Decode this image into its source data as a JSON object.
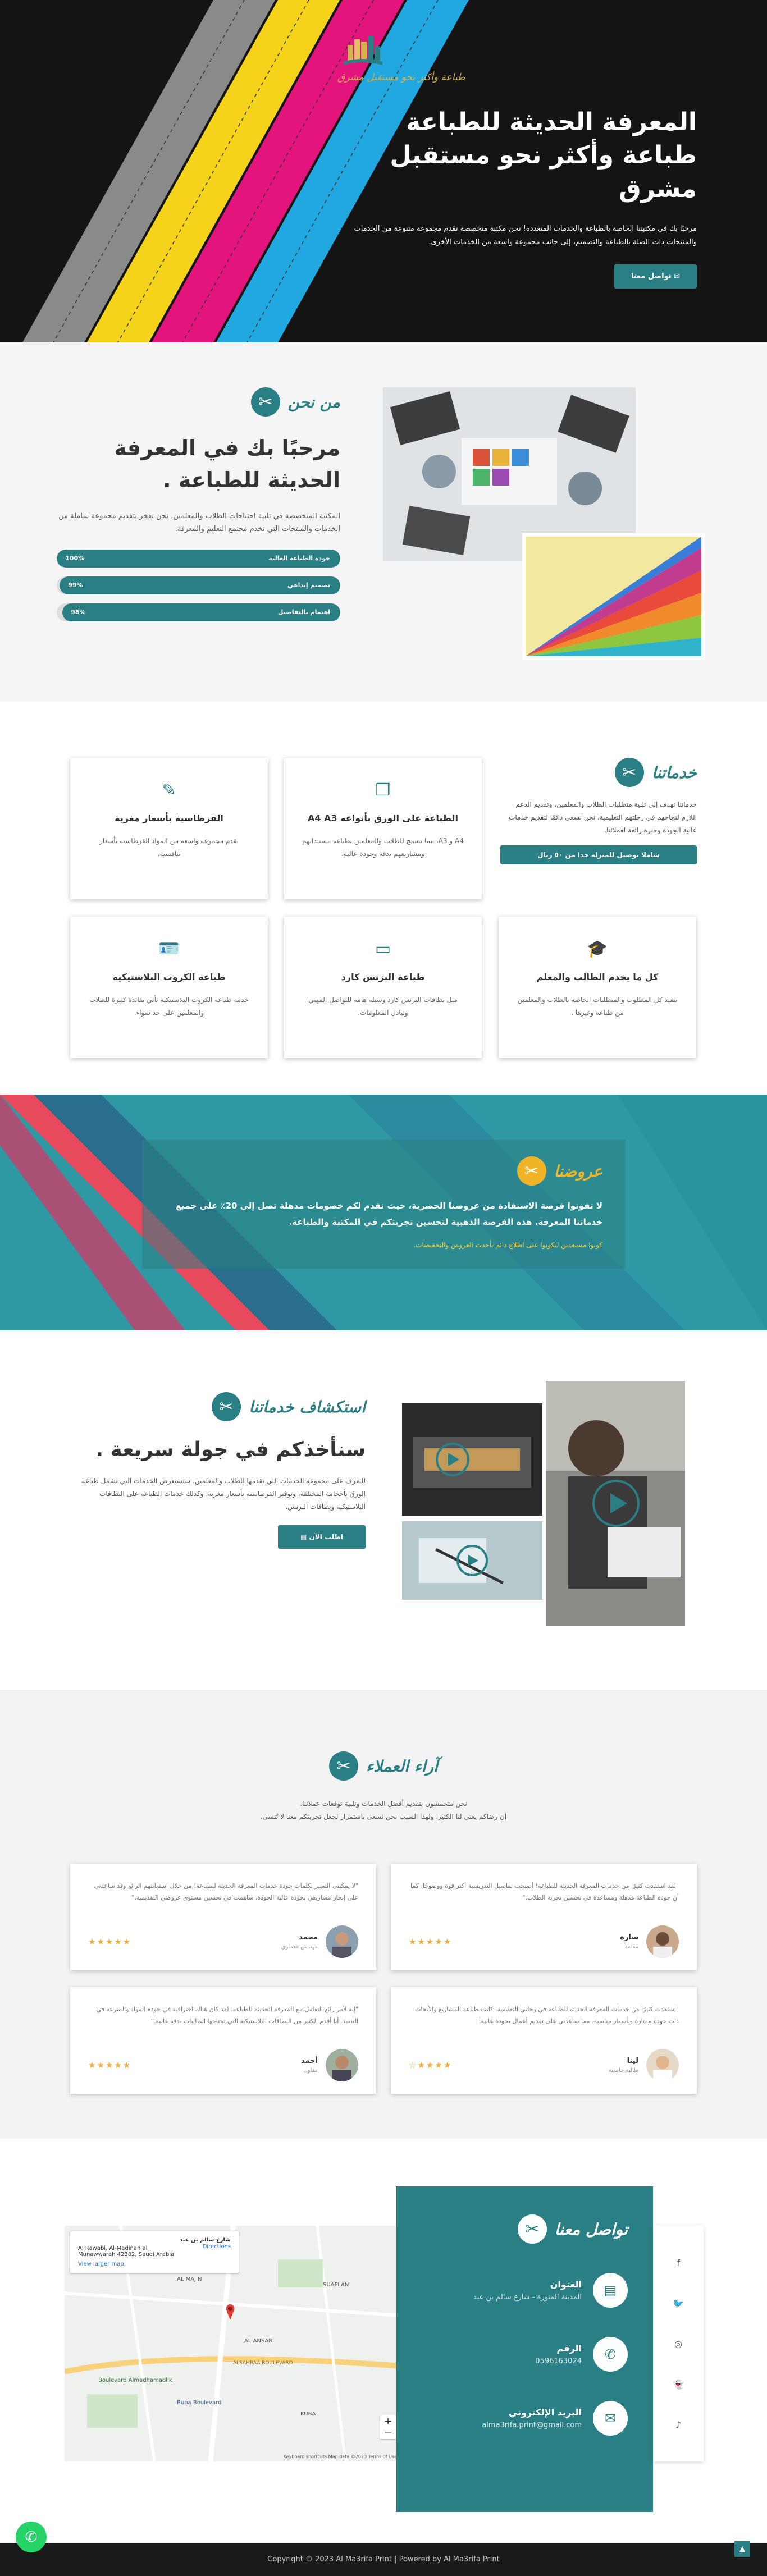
{
  "hero": {
    "tagline": "طباعة وأكثر نحو مستقبل مشرق",
    "title_line1": "المعرفة الحديثة للطباعة",
    "title_line2": "طباعة وأكثر نحو مستقبل مشرق",
    "description": "مرحبًا بك في مكتبتنا الخاصة بالطباعة والخدمات المتعددة! نحن مكتبة متخصصة تقدم مجموعة متنوعة من الخدمات والمنتجات ذات الصلة بالطباعة والتصميم، إلى جانب مجموعة واسعة من الخدمات الأخرى.",
    "cta": "تواصل معنا"
  },
  "about": {
    "badge": "من نحن",
    "title": "مرحبًا بك في المعرفة الحديثة للطباعة .",
    "description": "المكتبة المتخصصة في تلبية احتياجات الطلاب والمعلمين. نحن نفخر بتقديم مجموعة شاملة من الخدمات والمنتجات التي تخدم مجتمع التعليم والمعرفة.",
    "bars": [
      {
        "label": "جودة الطباعة العالية",
        "value": "100%",
        "fraction": 1.0
      },
      {
        "label": "تصميم إبداعي",
        "value": "99%",
        "fraction": 0.99
      },
      {
        "label": "اهتمام بالتفاصيل",
        "value": "98%",
        "fraction": 0.98
      }
    ]
  },
  "services": {
    "badge": "خدماتنا",
    "description": "خدماتنا تهدف إلى تلبية متطلبات الطلاب والمعلمين، وتقديم الدعم اللازم لنجاحهم في رحلتهم التعليمية. نحن نسعى دائمًا لتقديم خدمات عالية الجودة وخبرة رائعة لعملائنا.",
    "button": "شاملا توصيل للمنزلة جدا من ٥٠ ريال",
    "cards": [
      {
        "icon": "pencil-icon",
        "title": "القرطاسية بأسعار مغرية",
        "desc": "نقدم مجموعة واسعة من المواد القرطاسية بأسعار تنافسية."
      },
      {
        "icon": "copy-icon",
        "title": "الطباعة على الورق بأنواعه A4 A3",
        "desc": "A4 و A3، مما يسمح للطلاب والمعلمين بطباعة مستنداتهم ومشاريعهم بدقة وجودة عالية."
      },
      {
        "icon": "id-card-icon",
        "title": "طباعة الكروت البلاستيكية",
        "desc": "خدمة طباعة الكروت البلاستيكية تأتي بفائدة كبيرة للطلاب والمعلمين على حد سواء."
      },
      {
        "icon": "credit-card-icon",
        "title": "طباعة البزنس كارد",
        "desc": "مثل بطاقات البزنس كارد وسيلة هامة للتواصل المهني وتبادل المعلومات."
      },
      {
        "icon": "graduate-icon",
        "title": "كل ما يخدم الطالب والمعلم",
        "desc": "تنفيذ كل المطلوب والمتطلبات الخاصة بالطلاب والمعلمين من طباعة وغيرها ."
      }
    ]
  },
  "offers": {
    "badge": "عروضنا",
    "text": "لا تفوتوا فرصة الاستفادة من عروضنا الحصرية، حيث نقدم لكم خصومات مذهلة تصل إلى 20٪ على جميع خدماتنا المعرفة. هذه الفرصة الذهبية لتحسين تجربتكم في المكتبة والطباعة.",
    "subtext": "كونوا مستعدين لتكونوا على اطلاع دائم بأحدث العروض والتخفيضات."
  },
  "tour": {
    "badge": "استكشاف خدماتنا",
    "title": "سنأخذكم في جولة سريعة .",
    "description": "للتعرف على مجموعة الخدمات التي نقدمها للطلاب والمعلمين. ستستعرض الخدمات التي تشمل طباعة الورق بأحجامه المختلفة، وتوفير القرطاسية بأسعار مغرية، وكذلك خدمات الطباعة على البطاقات البلاستيكية وبطاقات البزنس.",
    "button": "اطلب الآن"
  },
  "testimonials": {
    "badge": "آراء العملاء",
    "description_line1": "نحن متحمسون بتقديم أفضل الخدمات وتلبية توقعات عملائنا.",
    "description_line2": "إن رضاكم يعني لنا الكثير، ولهذا السبب نحن نسعى باستمرار لجعل تجربتكم معنا لا تُنسى.",
    "items": [
      {
        "quote": "\"لقد استفدت كثيرًا من خدمات المعرفة الحديثة للطباعة! أصبحت تفاصيل التدريسية أكثر قوة ووضوحًا، كما أن جودة الطباعة مذهلة ومساعدة في تحسين تجربة الطلاب.\"",
        "name": "سارة",
        "role": "معلمة",
        "stars": "★★★★★"
      },
      {
        "quote": "\"لا يمكنني التعبير بكلمات جودة خدمات المعرفة الحديثة للطباعة! من خلال استعانتهم الرائع وقد ساعدني على إنجاز مشاريعي بجودة عالية الجودة، ساهمت في تحسين مستوى عروضي التقديمية.\"",
        "name": "محمد",
        "role": "مهندس معماري",
        "stars": "★★★★★"
      },
      {
        "quote": "\"استفدت كثيرًا من خدمات المعرفة الحديثة للطباعة في رحلتي التعليمية. كانت طباعة المشاريع والأبحاث ذات جودة ممتازة وبأسعار مناسبة، مما ساعدني على تقديم أعمال بجودة عالية.\"",
        "name": "لينا",
        "role": "طالبة جامعية",
        "stars": "★★★★☆"
      },
      {
        "quote": "\"إنه لأمر رائع التعامل مع المعرفة الحديثة للطباعة. لقد كان هناك احترافية في جودة المواد والسرعة في التنفيذ. أنا أقدم الكثير من البطاقات البلاستيكية التي تحتاجها الطالبات بدقة عالية.\"",
        "name": "أحمد",
        "role": "مقاول",
        "stars": "★★★★★"
      }
    ]
  },
  "contact": {
    "badge": "تواصل معنا",
    "address_label": "العنوان",
    "address_value": "المدينة المنورة - شارع سالم بن عبد",
    "phone_label": "الرقم",
    "phone_value": "0596163024",
    "email_label": "البريد الإلكتروني",
    "email_value": "alma3rifa.print@gmail.com",
    "map_place": "شارع سالم بن عبد",
    "map_address": "Al Rawabi, Al-Madinah al Munawwarah 42382, Saudi Arabia",
    "map_directions": "Directions",
    "map_larger": "View larger map",
    "map_footer": "Keyboard shortcuts   Map data ©2023   Terms of Use",
    "map_labels": [
      "Boulevard Almadhamadlik",
      "ALSAHRAA BOULEVARD",
      "Buba Boulevard",
      "KUBA",
      "AL ANSAR",
      "SUAFLAN",
      "AL MAJIN"
    ]
  },
  "footer": {
    "copyright": "Copyright © 2023 Al Ma3rifa Print | Powered by Al Ma3rifa Print"
  },
  "colors": {
    "accent": "#2a7f84",
    "offers_bg": "#2f99a3",
    "hero_bg": "#141414",
    "stripe_yellow": "#f5d31a",
    "stripe_magenta": "#e3147c",
    "stripe_blue": "#21a8e0"
  }
}
